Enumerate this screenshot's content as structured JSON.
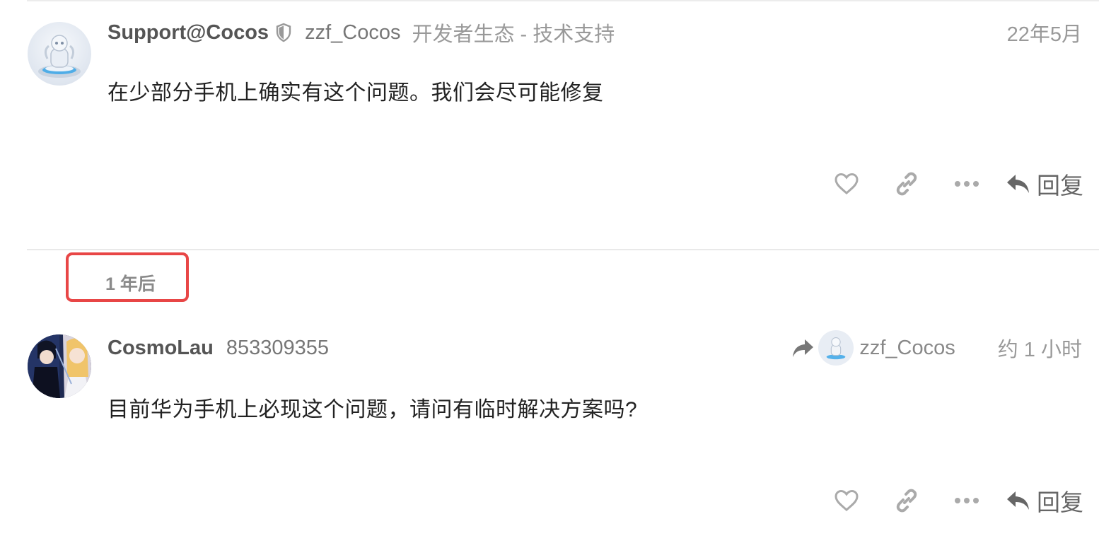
{
  "post1": {
    "username": "Support@Cocos",
    "name": "zzf_Cocos",
    "flair": "开发者生态 - 技术支持",
    "date": "22年5月",
    "body": "在少部分手机上确实有这个问题。我们会尽可能修复",
    "reply_label": "回复"
  },
  "time_gap": {
    "label": "1 年后",
    "highlight_color": "#e84646"
  },
  "post2": {
    "username": "CosmoLau",
    "name": "853309355",
    "reply_to_name": "zzf_Cocos",
    "date": "约 1 小时",
    "body": "目前华为手机上必现这个问题，请问有临时解决方案吗?",
    "reply_label": "回复"
  },
  "icons": {
    "like": "heart-icon",
    "link": "link-icon",
    "more": "ellipsis-icon",
    "reply": "reply-arrow-icon",
    "shield": "shield-icon",
    "reply_to": "share-arrow-icon"
  },
  "colors": {
    "icon": "#aaaaaa",
    "reply_icon": "#666666",
    "divider": "#e9e9e9"
  }
}
